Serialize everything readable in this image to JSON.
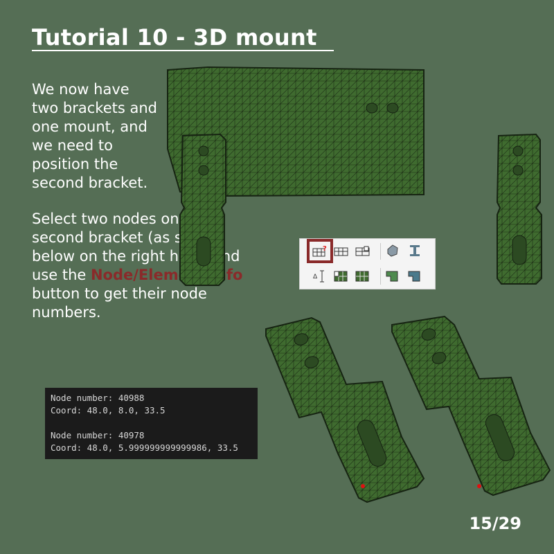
{
  "slide": {
    "title": "Tutorial 10 - 3D mount",
    "intro_lines": [
      "We now have",
      "two brackets and",
      "one mount, and",
      "we need to",
      "position the",
      "second bracket."
    ],
    "instruction_before": "Select two nodes on the second bracket (as shown below on the right here) and use the ",
    "instruction_highlight": "Node/Element Info",
    "instruction_after": " button to get their node numbers.",
    "highlight_color": "#8a2a2a",
    "page_indicator": "15/29"
  },
  "console": {
    "lines": [
      "Node number: 40988",
      "Coord: 48.0, 8.0, 33.5",
      "",
      "Node number: 40978",
      "Coord: 48.0, 5.999999999999986, 33.5"
    ]
  },
  "toolbar": {
    "row1": [
      "node-element-info-icon",
      "mesh-grid-icon",
      "mesh-grid-alt-icon",
      "geometry-solid-icon",
      "beam-section-icon"
    ],
    "row2": [
      "measure-icon",
      "mesh-quality-icon",
      "mesh-fill-icon",
      "surface-select-icon",
      "surface-edit-icon"
    ],
    "selected": "node-element-info-icon",
    "selected_color": "#8a2a2a"
  },
  "mesh_color": "#3f6b2f"
}
